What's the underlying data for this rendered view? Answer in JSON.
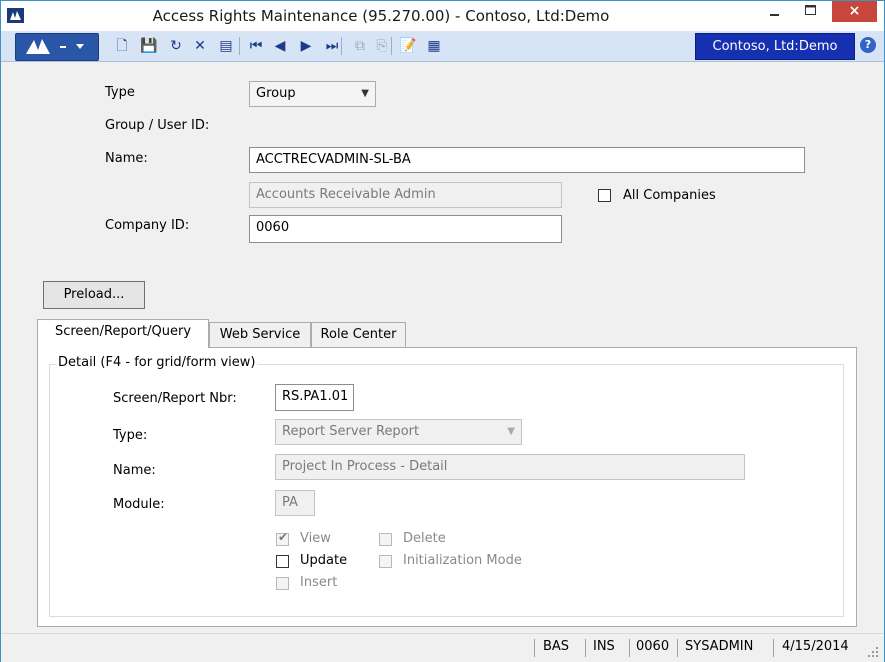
{
  "window": {
    "title": "Access Rights Maintenance (95.270.00) - Contoso, Ltd:Demo",
    "close_glyph": "×"
  },
  "toolbar": {
    "company": "Contoso, Ltd:Demo",
    "help_glyph": "?",
    "buttons": [
      {
        "name": "new-icon",
        "glyph": "🗋",
        "enabled": true
      },
      {
        "name": "save-icon",
        "glyph": "💾",
        "enabled": true
      },
      {
        "name": "refresh-icon",
        "glyph": "↻",
        "enabled": true
      },
      {
        "name": "delete-icon",
        "glyph": "✕",
        "enabled": true
      },
      {
        "name": "save-as-icon",
        "glyph": "▤",
        "enabled": true
      },
      {
        "name": "first-icon",
        "glyph": "⏮",
        "enabled": true
      },
      {
        "name": "previous-icon",
        "glyph": "◀",
        "enabled": true
      },
      {
        "name": "next-icon",
        "glyph": "▶",
        "enabled": true
      },
      {
        "name": "last-icon",
        "glyph": "⏭",
        "enabled": true
      },
      {
        "name": "copy-icon",
        "glyph": "⧉",
        "enabled": false
      },
      {
        "name": "paste-icon",
        "glyph": "⎘",
        "enabled": false
      },
      {
        "name": "notes-icon",
        "glyph": "📝",
        "enabled": true
      },
      {
        "name": "excel-icon",
        "glyph": "▦",
        "enabled": true
      }
    ]
  },
  "form": {
    "type_label": "Type",
    "type_value": "Group",
    "group_user_label": "Group / User ID:",
    "group_user_value": "ACCTRECVADMIN-SL-BA",
    "name_label": "Name:",
    "name_value": "Accounts Receivable Admin",
    "all_companies_label": "All Companies",
    "all_companies_checked": false,
    "company_id_label": "Company ID:",
    "company_id_value": "0060",
    "preload_button": "Preload..."
  },
  "tabs": [
    {
      "label": "Screen/Report/Query",
      "active": true
    },
    {
      "label": "Web Service",
      "active": false
    },
    {
      "label": "Role Center",
      "active": false
    }
  ],
  "detail": {
    "group_title": "Detail (F4 - for grid/form view)",
    "screen_nbr_label": "Screen/Report Nbr:",
    "screen_nbr_value": "RS.PA1.01",
    "type_label": "Type:",
    "type_value": "Report Server Report",
    "name_label": "Name:",
    "name_value": "Project In Process - Detail",
    "module_label": "Module:",
    "module_value": "PA",
    "checkboxes": {
      "view": {
        "label": "View",
        "checked": true,
        "enabled": false
      },
      "update": {
        "label": "Update",
        "checked": false,
        "enabled": true
      },
      "insert": {
        "label": "Insert",
        "checked": false,
        "enabled": false
      },
      "delete": {
        "label": "Delete",
        "checked": false,
        "enabled": false
      },
      "init_mode": {
        "label": "Initialization Mode",
        "checked": false,
        "enabled": false
      }
    }
  },
  "status": {
    "mode": "BAS",
    "insert": "INS",
    "company": "0060",
    "user": "SYSADMIN",
    "date": "4/15/2014"
  }
}
